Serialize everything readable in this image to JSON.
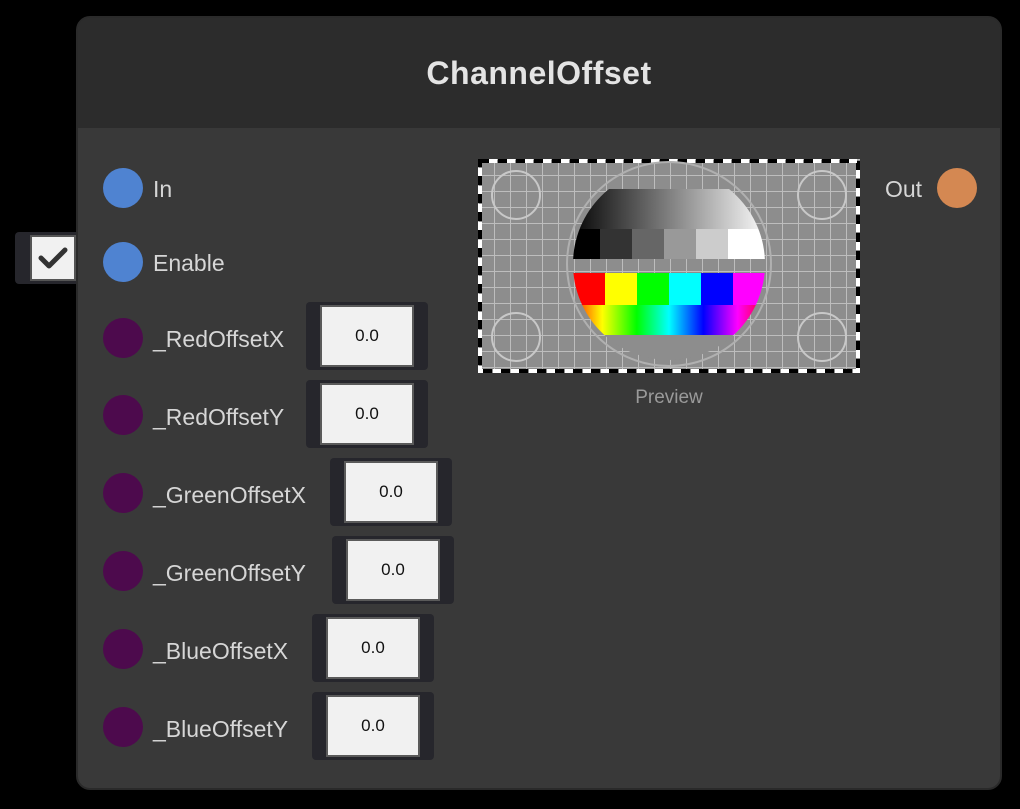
{
  "node": {
    "title": "ChannelOffset"
  },
  "inputs": [
    {
      "label": "In",
      "port_color": "#4f83d1"
    },
    {
      "label": "Enable",
      "port_color": "#4f83d1",
      "checked": true
    }
  ],
  "params": [
    {
      "label": "_RedOffsetX",
      "value": "0.0"
    },
    {
      "label": "_RedOffsetY",
      "value": "0.0"
    },
    {
      "label": "_GreenOffsetX",
      "value": "0.0"
    },
    {
      "label": "_GreenOffsetY",
      "value": "0.0"
    },
    {
      "label": "_BlueOffsetX",
      "value": "0.0"
    },
    {
      "label": "_BlueOffsetY",
      "value": "0.0"
    }
  ],
  "output": {
    "label": "Out",
    "port_color": "#d48852"
  },
  "preview": {
    "label": "Preview"
  },
  "colors": {
    "param_port": "#4d0a4d",
    "node_bg": "#393939",
    "header_bg": "#2c2c2c"
  }
}
